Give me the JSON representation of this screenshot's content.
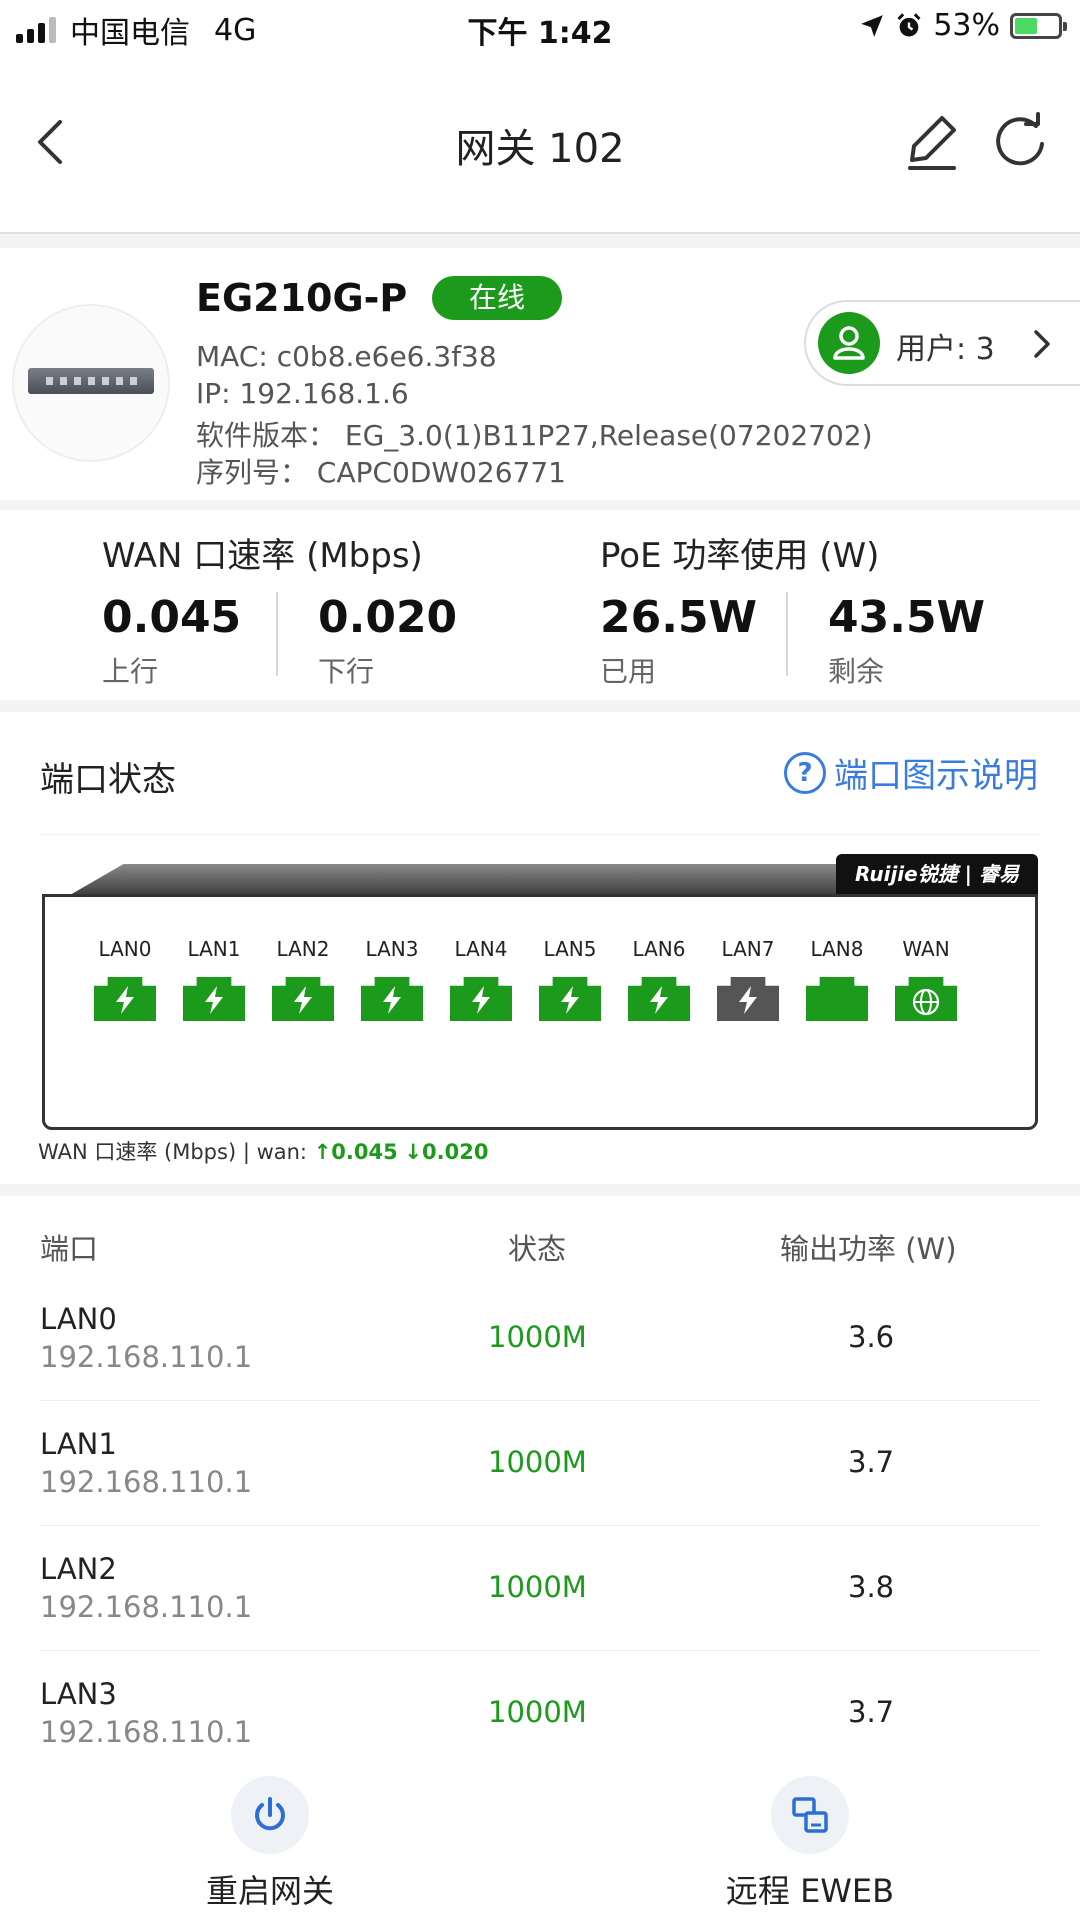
{
  "status_bar": {
    "carrier": "中国电信",
    "network": "4G",
    "time": "下午 1:42",
    "battery": "53%",
    "battery_level": 0.53
  },
  "nav": {
    "title": "网关 102",
    "back_icon": "chevron-left-icon",
    "edit_icon": "pencil-icon",
    "refresh_icon": "refresh-icon"
  },
  "device": {
    "model": "EG210G-P",
    "status": "在线",
    "mac": "MAC:  c0b8.e6e6.3f38",
    "ip": "IP:  192.168.1.6",
    "software": "软件版本：  EG_3.0(1)B11P27,Release(07202702)",
    "serial": "序列号：  CAPC0DW026771",
    "users_label": "用户: 3"
  },
  "stats": {
    "wan_title": "WAN 口速率 (Mbps)",
    "up_value": "0.045",
    "up_label": "上行",
    "down_value": "0.020",
    "down_label": "下行",
    "poe_title": "PoE 功率使用 (W)",
    "used_value": "26.5W",
    "used_label": "已用",
    "remaining_value": "43.5W",
    "remaining_label": "剩余"
  },
  "port_status": {
    "title": "端口状态",
    "help_label": "端口图示说明",
    "brand": "Ruijie锐捷 | 睿易",
    "ports": [
      {
        "label": "LAN0",
        "kind": "poe",
        "color": "#1c9a1c"
      },
      {
        "label": "LAN1",
        "kind": "poe",
        "color": "#1c9a1c"
      },
      {
        "label": "LAN2",
        "kind": "poe",
        "color": "#1c9a1c"
      },
      {
        "label": "LAN3",
        "kind": "poe",
        "color": "#1c9a1c"
      },
      {
        "label": "LAN4",
        "kind": "poe",
        "color": "#1c9a1c"
      },
      {
        "label": "LAN5",
        "kind": "poe",
        "color": "#1c9a1c"
      },
      {
        "label": "LAN6",
        "kind": "poe",
        "color": "#1c9a1c"
      },
      {
        "label": "LAN7",
        "kind": "poe",
        "color": "#555555"
      },
      {
        "label": "LAN8",
        "kind": "plain",
        "color": "#1c9a1c"
      },
      {
        "label": "WAN",
        "kind": "wan",
        "color": "#1c9a1c"
      }
    ],
    "wan_rate_prefix": "WAN 口速率 (Mbps) | wan: ",
    "wan_up": "↑0.045",
    "wan_down": "↓0.020"
  },
  "table": {
    "headers": {
      "port": "端口",
      "status": "状态",
      "power": "输出功率 (W)"
    },
    "rows": [
      {
        "name": "LAN0",
        "ip": "192.168.110.1",
        "status": "1000M",
        "power": "3.6"
      },
      {
        "name": "LAN1",
        "ip": "192.168.110.1",
        "status": "1000M",
        "power": "3.7"
      },
      {
        "name": "LAN2",
        "ip": "192.168.110.1",
        "status": "1000M",
        "power": "3.8"
      },
      {
        "name": "LAN3",
        "ip": "192.168.110.1",
        "status": "1000M",
        "power": "3.7"
      }
    ]
  },
  "bottom_bar": {
    "restart_label": "重启网关",
    "restart_icon": "power-icon",
    "eweb_label": "远程 EWEB",
    "eweb_icon": "remote-devices-icon"
  },
  "colors": {
    "accent_green": "#1c9a1c",
    "link_blue": "#3a7be0"
  }
}
